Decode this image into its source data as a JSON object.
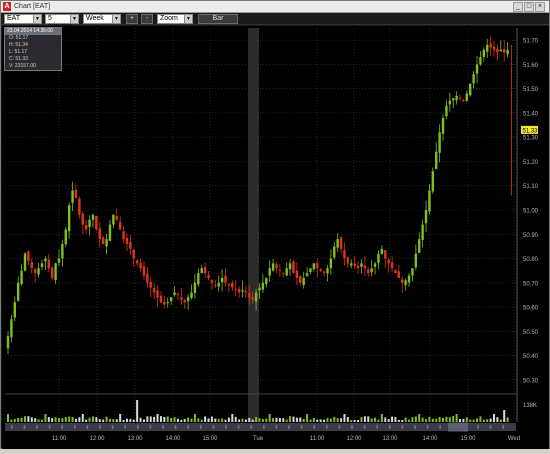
{
  "window": {
    "title": "Chart [EAT]",
    "app_icon": "app-logo-icon",
    "controls": [
      "minimize-icon",
      "maximize-icon",
      "close-icon"
    ],
    "control_glyphs": [
      "_",
      "□",
      "×"
    ]
  },
  "toolbar": {
    "symbol": "EAT",
    "interval": "5 minutes",
    "range": "Week",
    "zoom_in": "+",
    "zoom_out": "-",
    "zoom": "Zoom",
    "chart_type": "Bar"
  },
  "ohlc": {
    "header": "23.04.2014 14:35:00",
    "open": "O: 51.17",
    "high": "H: 51.34",
    "low": "L: 51.17",
    "close": "C: 51.33",
    "volume": "V: 23157.00"
  },
  "colors": {
    "up": "#7fc01f",
    "down": "#e23418",
    "grid": "#3a3a3a",
    "axis_text": "#b8b8b8",
    "price_label": "#f2e92c",
    "background": "#000000"
  },
  "chart_data": {
    "type": "bar",
    "description_style": "OHLC candlestick bars, 5-minute intervals",
    "y_ticks": [
      "51.70",
      "51.60",
      "51.50",
      "51.40",
      "51.30",
      "51.20",
      "51.10",
      "51.00",
      "50.90",
      "50.80",
      "50.70",
      "50.60",
      "50.50",
      "50.40",
      "50.30"
    ],
    "ylim": [
      50.25,
      51.75
    ],
    "x_ticks": [
      "11:00",
      "12:00",
      "13:00",
      "14:00",
      "15:00",
      "Tue",
      "11:00",
      "12:00",
      "13:00",
      "14:00",
      "15:00",
      "Wed"
    ],
    "current_price": "51.33",
    "volume_label": "138K",
    "grid": true,
    "close_path": [
      50.48,
      50.55,
      50.62,
      50.7,
      50.75,
      50.82,
      50.79,
      50.76,
      50.74,
      50.76,
      50.78,
      50.8,
      50.76,
      50.72,
      50.78,
      50.8,
      50.86,
      50.92,
      51.02,
      51.08,
      51.05,
      50.98,
      50.94,
      50.92,
      50.96,
      50.98,
      50.92,
      50.88,
      50.86,
      50.88,
      50.94,
      50.98,
      50.96,
      50.92,
      50.88,
      50.86,
      50.84,
      50.8,
      50.78,
      50.76,
      50.73,
      50.7,
      50.68,
      50.66,
      50.64,
      50.62,
      50.61,
      50.62,
      50.64,
      50.66,
      50.65,
      50.63,
      50.62,
      50.64,
      50.66,
      50.7,
      50.74,
      50.76,
      50.74,
      50.72,
      50.7,
      50.69,
      50.7,
      50.72,
      50.7,
      50.69,
      50.68,
      50.67,
      50.66,
      50.67,
      50.66,
      50.64,
      50.63,
      50.66,
      50.68,
      50.7,
      50.72,
      50.76,
      50.78,
      50.76,
      50.75,
      50.74,
      50.76,
      50.78,
      50.74,
      50.72,
      50.7,
      50.72,
      50.74,
      50.76,
      50.78,
      50.76,
      50.75,
      50.74,
      50.76,
      50.8,
      50.85,
      50.88,
      50.84,
      50.8,
      50.78,
      50.78,
      50.77,
      50.76,
      50.78,
      50.76,
      50.74,
      50.76,
      50.78,
      50.82,
      50.84,
      50.8,
      50.78,
      50.76,
      50.74,
      50.72,
      50.7,
      50.71,
      50.73,
      50.76,
      50.82,
      50.88,
      50.94,
      51.0,
      51.08,
      51.16,
      51.24,
      51.32,
      51.38,
      51.43,
      51.45,
      51.46,
      51.47,
      51.46,
      51.45,
      51.48,
      51.52,
      51.56,
      51.6,
      51.63,
      51.66,
      51.68,
      51.67,
      51.66,
      51.65,
      51.66,
      51.65,
      51.66
    ]
  }
}
